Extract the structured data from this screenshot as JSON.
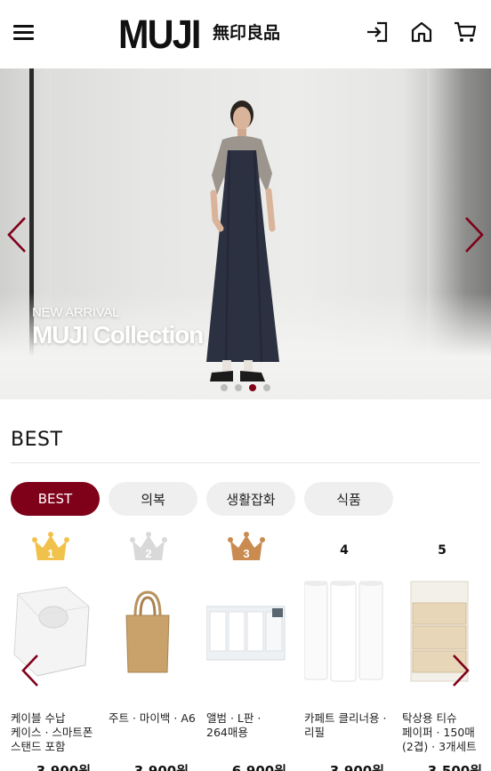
{
  "header": {
    "brand_latin": "MUJI",
    "brand_kanji": "無印良品",
    "icons": [
      "menu-icon",
      "login-icon",
      "home-icon",
      "cart-icon"
    ]
  },
  "banner": {
    "subtitle": "NEW ARRIVAL",
    "title": "MUJI Collection",
    "slide_count": 4,
    "active_slide": 3,
    "arrow_color": "#7f0019"
  },
  "best": {
    "title": "BEST",
    "tabs": [
      {
        "label": "BEST",
        "active": true
      },
      {
        "label": "의복",
        "active": false
      },
      {
        "label": "생활잡화",
        "active": false
      },
      {
        "label": "식품",
        "active": false
      }
    ],
    "products": [
      {
        "rank": "1",
        "crown": "gold",
        "name": "케이블 수납 케이스 · 스마트폰 스탠드 포함",
        "price": "3,900원"
      },
      {
        "rank": "2",
        "crown": "silver",
        "name": "주트 · 마이백 · A6",
        "price": "3,900원"
      },
      {
        "rank": "3",
        "crown": "bronze",
        "name": "앨범 · L판 · 264매용",
        "price": "6,900원"
      },
      {
        "rank": "4",
        "crown": "none",
        "name": "카페트 클리너용 · 리필",
        "price": "3,900원"
      },
      {
        "rank": "5",
        "crown": "none",
        "name": "탁상용 티슈 페이퍼 · 150매(2겹) · 3개세트",
        "price": "3,500원"
      }
    ]
  },
  "colors": {
    "accent": "#7f0019",
    "tab_inactive": "#efefef",
    "crown_gold": "#f1c24b",
    "crown_silver": "#d9d9d9",
    "crown_bronze": "#c98b4f"
  }
}
